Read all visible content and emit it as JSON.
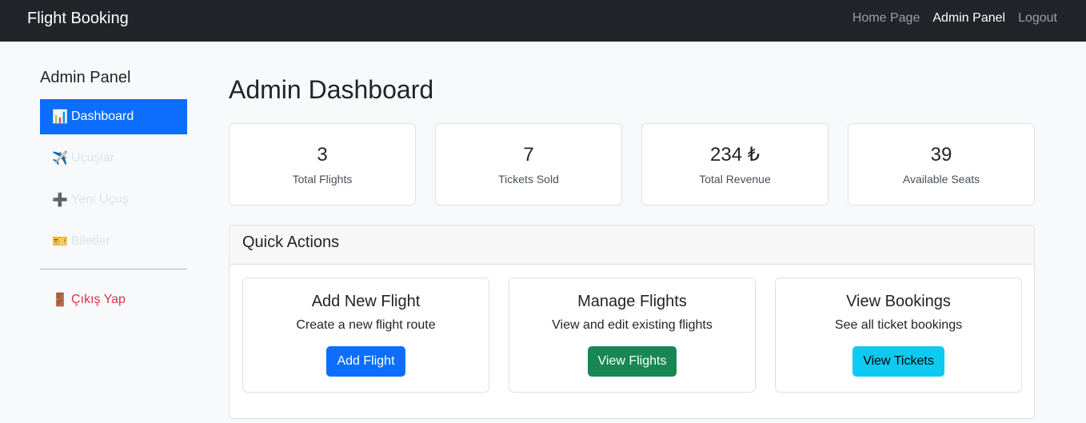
{
  "navbar": {
    "brand": "Flight Booking",
    "links": [
      {
        "label": "Home Page"
      },
      {
        "label": "Admin Panel"
      },
      {
        "label": "Logout"
      }
    ]
  },
  "sidebar": {
    "title": "Admin Panel",
    "items": [
      {
        "icon": "📊",
        "icon_name": "chart-icon",
        "label": "Dashboard"
      },
      {
        "icon": "✈️",
        "icon_name": "airplane-icon",
        "label": "Uçuşlar"
      },
      {
        "icon": "➕",
        "icon_name": "plus-icon",
        "label": "Yeni Uçuş"
      },
      {
        "icon": "🎫",
        "icon_name": "ticket-icon",
        "label": "Biletler"
      }
    ],
    "logout": {
      "icon": "🚪",
      "icon_name": "door-icon",
      "label": "Çıkış Yap"
    }
  },
  "main": {
    "title": "Admin Dashboard",
    "stats": [
      {
        "value": "3",
        "label": "Total Flights"
      },
      {
        "value": "7",
        "label": "Tickets Sold"
      },
      {
        "value": "234 ₺",
        "label": "Total Revenue"
      },
      {
        "value": "39",
        "label": "Available Seats"
      }
    ],
    "quick_actions": {
      "title": "Quick Actions",
      "cards": [
        {
          "title": "Add New Flight",
          "desc": "Create a new flight route",
          "button": "Add Flight"
        },
        {
          "title": "Manage Flights",
          "desc": "View and edit existing flights",
          "button": "View Flights"
        },
        {
          "title": "View Bookings",
          "desc": "See all ticket bookings",
          "button": "View Tickets"
        }
      ]
    }
  },
  "colors": {
    "primary": "#0d6efd",
    "success": "#198754",
    "info": "#0dcaf0",
    "danger": "#dc3545",
    "navbar": "#212529"
  }
}
